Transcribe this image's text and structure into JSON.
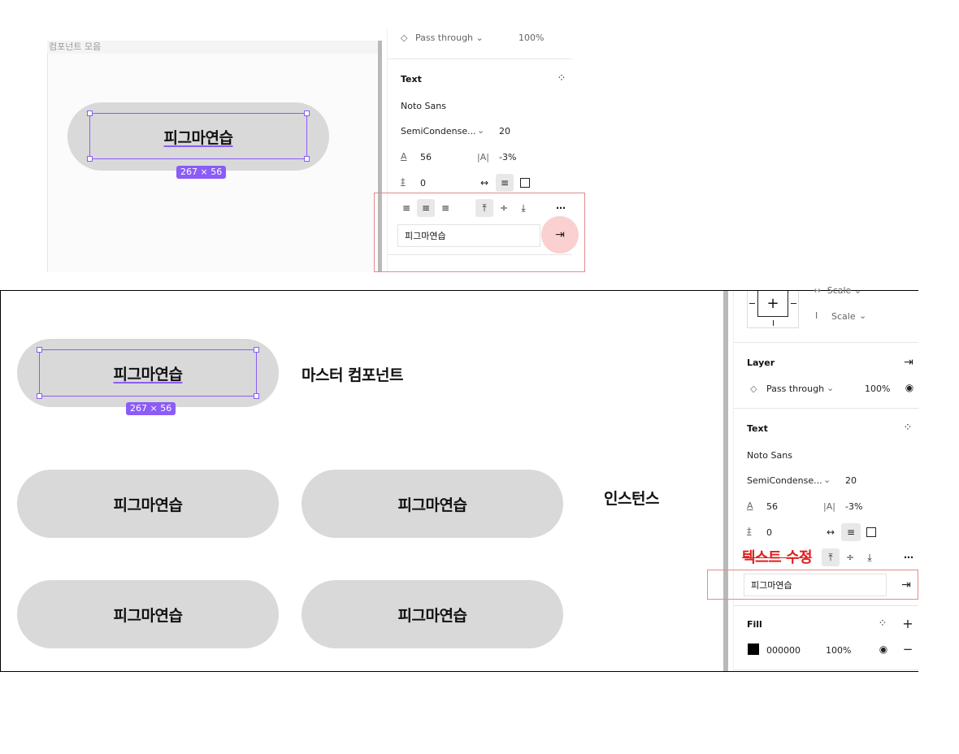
{
  "top": {
    "canvas_label": "컴포넌트 모음",
    "pill_text": "피그마연습",
    "dim_badge": "267 × 56",
    "panel": {
      "layer_blend": "Pass through",
      "layer_opacity": "100%",
      "text_section": "Text",
      "font_family": "Noto Sans",
      "font_style": "SemiCondense...",
      "font_size": "20",
      "line_height": "56",
      "letter_spacing": "-3%",
      "paragraph_spacing": "0",
      "text_value": "피그마연습"
    }
  },
  "bottom": {
    "master_pill_text": "피그마연습",
    "dim_badge": "267 × 56",
    "master_label": "마스터 컴포넌트",
    "instances_label": "인스턴스",
    "instances": [
      "피그마연습",
      "피그마연습",
      "피그마연습",
      "피그마연습"
    ],
    "panel": {
      "constraint_h": "Scale",
      "constraint_v": "Scale",
      "layer_section": "Layer",
      "layer_blend": "Pass through",
      "layer_opacity": "100%",
      "text_section": "Text",
      "font_family": "Noto Sans",
      "font_style": "SemiCondense...",
      "font_size": "20",
      "line_height": "56",
      "letter_spacing": "-3%",
      "paragraph_spacing": "0",
      "annotation": "텍스트 수정",
      "text_value": "피그마연습",
      "fill_section": "Fill",
      "fill_hex": "000000",
      "fill_opacity": "100%"
    }
  },
  "colors": {
    "selection": "#8b5cf6",
    "pill": "#d9d9d9",
    "annotation_red": "#e11d1d",
    "highlight_rect": "#e58b8b",
    "fill_swatch": "#000000"
  }
}
